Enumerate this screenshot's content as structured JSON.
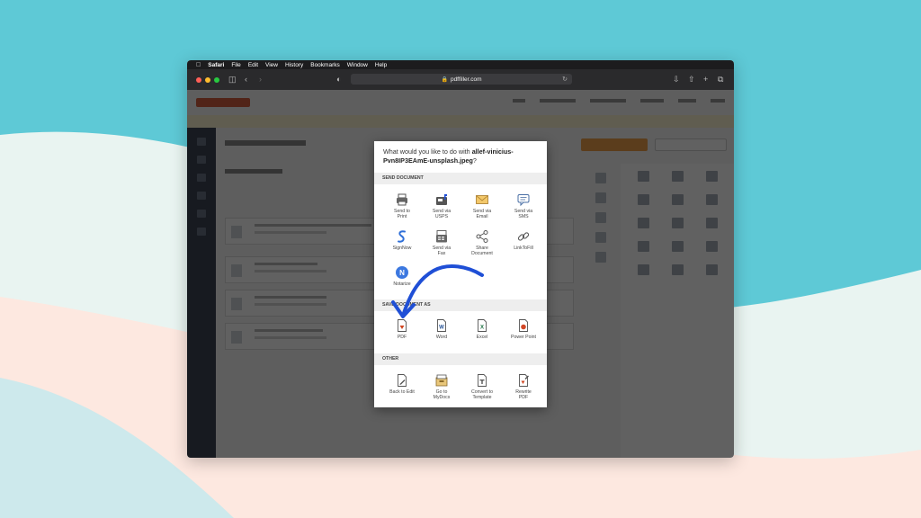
{
  "menubar": {
    "app_name": "Safari",
    "items": [
      "File",
      "Edit",
      "View",
      "History",
      "Bookmarks",
      "Window",
      "Help"
    ]
  },
  "browser": {
    "url": "pdffiller.com"
  },
  "modal": {
    "question": "What would you like to do with ",
    "filename": "allef-vinicius-Pvn8IP3EAmE-unsplash.jpeg",
    "question_end": "?",
    "sections": {
      "send": {
        "title": "SEND DOCUMENT",
        "items": [
          {
            "label": "Send to\nPrint",
            "icon": "printer-icon"
          },
          {
            "label": "Send via\nUSPS",
            "icon": "mailbox-icon"
          },
          {
            "label": "Send via\nEmail",
            "icon": "envelope-icon"
          },
          {
            "label": "Send via\nSMS",
            "icon": "chat-bubble-icon"
          },
          {
            "label": "SignNow",
            "icon": "signnow-icon"
          },
          {
            "label": "Send via\nFax",
            "icon": "fax-icon"
          },
          {
            "label": "Share\nDocument",
            "icon": "share-icon"
          },
          {
            "label": "LinkToFill",
            "icon": "link-icon"
          },
          {
            "label": "Notarize",
            "icon": "notarize-icon"
          }
        ]
      },
      "save": {
        "title": "SAVE DOCUMENT AS",
        "items": [
          {
            "label": "PDF",
            "icon": "pdf-file-icon"
          },
          {
            "label": "Word",
            "icon": "word-file-icon"
          },
          {
            "label": "Excel",
            "icon": "excel-file-icon"
          },
          {
            "label": "Power Point",
            "icon": "powerpoint-file-icon"
          }
        ]
      },
      "other": {
        "title": "OTHER",
        "items": [
          {
            "label": "Back to Edit",
            "icon": "back-edit-icon"
          },
          {
            "label": "Go to\nMyDocs",
            "icon": "mydocs-box-icon"
          },
          {
            "label": "Convert to\nTemplate",
            "icon": "template-icon"
          },
          {
            "label": "Rewrite\nPDF",
            "icon": "rewrite-pdf-icon"
          }
        ]
      }
    }
  },
  "colors": {
    "accent_blue": "#1f4fd6",
    "pdffiller_red": "#d0441f",
    "backdrop_teal": "#5ec9d6"
  }
}
